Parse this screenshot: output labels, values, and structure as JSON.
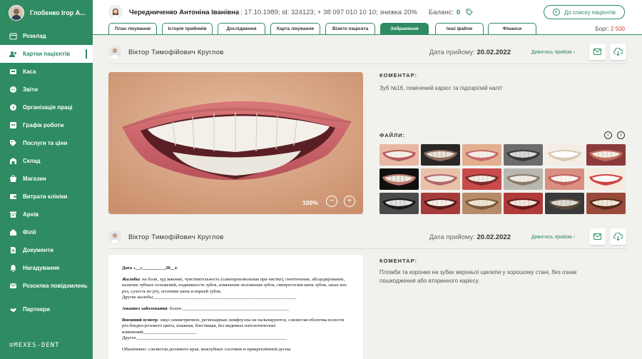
{
  "sidebar": {
    "user_name": "Глобенко Ігор А...",
    "items": [
      {
        "label": "Розклад",
        "icon": "calendar-icon"
      },
      {
        "label": "Картки пацієнтів",
        "icon": "patients-icon",
        "active": true
      },
      {
        "label": "Каса",
        "icon": "cash-register-icon"
      },
      {
        "label": "Звіти",
        "icon": "reports-icon"
      },
      {
        "label": "Організація праці",
        "icon": "work-organization-icon"
      },
      {
        "label": "Графік роботи",
        "icon": "work-schedule-icon"
      },
      {
        "label": "Послуги та ціни",
        "icon": "services-prices-icon"
      },
      {
        "label": "Склад",
        "icon": "warehouse-icon"
      },
      {
        "label": "Магазин",
        "icon": "shop-icon"
      },
      {
        "label": "Витрати клініки",
        "icon": "clinic-expenses-icon"
      },
      {
        "label": "Архів",
        "icon": "archive-icon"
      },
      {
        "label": "Філії",
        "icon": "branches-icon"
      },
      {
        "label": "Документи",
        "icon": "documents-icon"
      },
      {
        "label": "Нагадування",
        "icon": "reminders-icon"
      },
      {
        "label": "Розсилка повідомлень",
        "icon": "mailing-icon"
      },
      {
        "label": "Партнери",
        "icon": "partners-icon"
      }
    ],
    "logo": "≡MEXES-DENT"
  },
  "header": {
    "patient_name": "Чередниченко Антоніна Іванівна",
    "patient_info": "; 17.10.1989; id: 324123; + 38 097 010 10 10; знижка 20%",
    "balance_label": "Баланс:",
    "balance_value": "0",
    "back_button": "До списку пацієнтів"
  },
  "tabs": [
    {
      "label": "План лікування"
    },
    {
      "label": "Історія прийомів"
    },
    {
      "label": "Дослідження"
    },
    {
      "label": "Карта лікування"
    },
    {
      "label": "Візити пацієнта"
    },
    {
      "label": "Зображення",
      "active": true
    },
    {
      "label": "Інші файли"
    },
    {
      "label": "Фінанси"
    }
  ],
  "debt": {
    "label": "Борг:",
    "value": "2 500"
  },
  "records": [
    {
      "doctor": "Віктор Тимофійович Круглов",
      "date_label": "Дата прийому:",
      "date": "20.02.2022",
      "view_link": "Дивитись прийом",
      "comment_label": "КОМЕНТАР:",
      "comment": "Зуб №16, помічений карієс та підозрілий наліт",
      "files_label": "ФАЙЛИ:",
      "zoom": "100%"
    },
    {
      "doctor": "Віктор Тимофійович Круглов",
      "date_label": "Дата прийому:",
      "date": "20.02.2022",
      "view_link": "Дивитись прийом",
      "comment_label": "КОМЕНТАР:",
      "comment": "Пломби та коронки на зубах верхньої щелепи у хорошому стані, без ознак пошкодження або вторинного карієсу."
    }
  ],
  "document": {
    "date_line": "Дата «__»__________20__г.",
    "complaints_title": "Жалобы",
    "complaints_text": ": на боли, зуд жжение, чувствительность (самопроизвольная при чистке), гноетечение, абсцедирование, наличие зубных отложений, подвижность зубов, изменение положения зубов, гиперестезия шеек зубов, запах изо рта, сухость во рту, оголение шеек и корней зубов.",
    "other_complaints": "Другие жалобы",
    "anamnesis_title": "Анамнез заболевания",
    "anamnesis_text": ": болен",
    "exam_title": "Внешний осмотр",
    "exam_text": ": лицо симметричное, регионарные лимфоузлы не пальпируются, слизистая оболочка полости рта бледно-розового цвета, влажная, блестящая, без видимых патологических изменений",
    "other": "Другое",
    "objective": "Объективно: слизистая десневого края, межзубных сосочков и прикреплённой десны"
  },
  "colors": {
    "primary": "#2e8b62",
    "debt": "#d13b3b",
    "background": "#f1f1ee"
  }
}
